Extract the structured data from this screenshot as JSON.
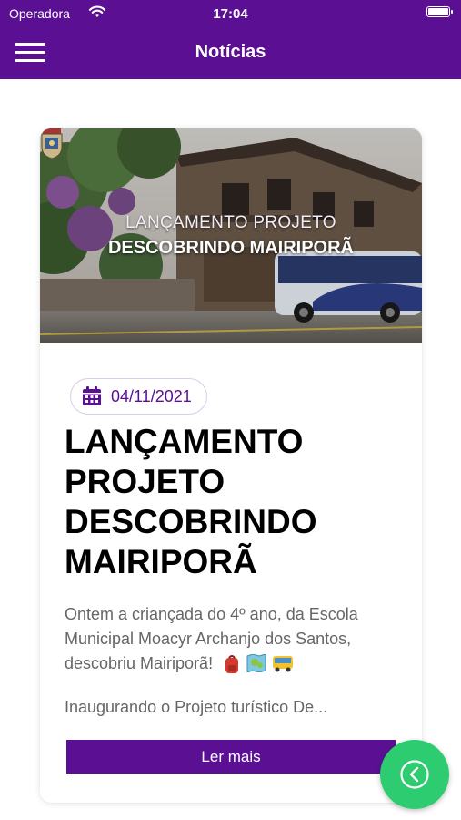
{
  "status_bar": {
    "carrier": "Operadora",
    "time": "17:04"
  },
  "navbar": {
    "title": "Notícias",
    "menu_icon": "hamburger-menu-icon"
  },
  "article": {
    "image_title_line1": "LANÇAMENTO PROJETO",
    "image_title_line2": "DESCOBRINDO MAIRIPORÃ",
    "date": "04/11/2021",
    "headline_lines": [
      "LANÇAMENTO",
      "PROJETO",
      "DESCOBRINDO",
      "MAIRIPORÃ"
    ],
    "excerpt_lines": [
      "Ontem a criançada do 4º ano, da Escola",
      "Municipal Moacyr Archanjo dos Santos,",
      "descobriu Mairiporã!"
    ],
    "excerpt_emojis": [
      "backpack-emoji",
      "map-emoji",
      "bus-emoji"
    ],
    "excerpt_2": "Inaugurando o Projeto turístico De...",
    "read_more_label": "Ler mais"
  },
  "fab": {
    "icon": "chevron-left-circle-icon"
  },
  "colors": {
    "primary": "#5b1094",
    "fab": "#2ecc71",
    "text_muted": "#666666"
  }
}
